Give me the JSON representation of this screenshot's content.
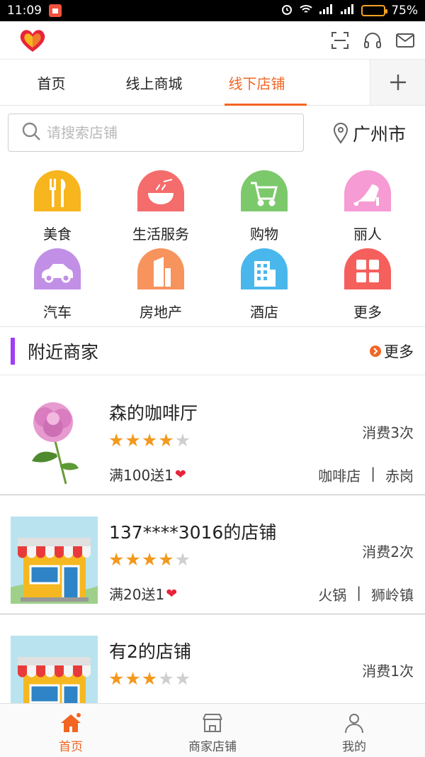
{
  "status_bar": {
    "time": "11:09",
    "battery": "75%",
    "battery_level": 0.75
  },
  "tabs": [
    {
      "label": "首页"
    },
    {
      "label": "线上商城"
    },
    {
      "label": "线下店铺",
      "active": true
    }
  ],
  "search": {
    "placeholder": "请搜索店铺",
    "city": "广州市"
  },
  "categories": [
    {
      "label": "美食",
      "color": "#f7b51e",
      "icon": "fork-knife-icon"
    },
    {
      "label": "生活服务",
      "color": "#f46c6c",
      "icon": "bowl-icon"
    },
    {
      "label": "购物",
      "color": "#7cc96c",
      "icon": "cart-icon"
    },
    {
      "label": "丽人",
      "color": "#f69bd4",
      "icon": "high-heel-icon"
    },
    {
      "label": "汽车",
      "color": "#c190e6",
      "icon": "car-icon"
    },
    {
      "label": "房地产",
      "color": "#f7935d",
      "icon": "building-icon"
    },
    {
      "label": "酒店",
      "color": "#49b7ec",
      "icon": "hotel-icon"
    },
    {
      "label": "更多",
      "color": "#f5605c",
      "icon": "grid-icon"
    }
  ],
  "nearby": {
    "title": "附近商家",
    "more": "更多",
    "shops": [
      {
        "name": "森的咖啡厅",
        "rating": 4,
        "promo": "满100送1",
        "visits": "消费3次",
        "category": "咖啡店",
        "sep": "|",
        "area": "赤岗",
        "thumb": "flower"
      },
      {
        "name": "137****3016的店铺",
        "rating": 4,
        "promo": "满20送1",
        "visits": "消费2次",
        "category": "火锅",
        "sep": "|",
        "area": "狮岭镇",
        "thumb": "storefront"
      },
      {
        "name": "有2的店铺",
        "rating": 3,
        "promo": "",
        "visits": "消费1次",
        "category": "",
        "sep": "",
        "area": "",
        "thumb": "storefront"
      }
    ]
  },
  "bottom_nav": [
    {
      "label": "首页",
      "active": true,
      "icon": "home-icon"
    },
    {
      "label": "商家店铺",
      "active": false,
      "icon": "store-icon"
    },
    {
      "label": "我的",
      "active": false,
      "icon": "user-icon"
    }
  ],
  "colors": {
    "accent": "#f26522",
    "star": "#f2991e",
    "section_bar": "#a23cf5"
  }
}
